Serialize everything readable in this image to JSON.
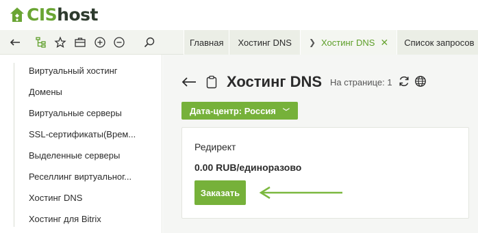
{
  "brand": {
    "logo_cis": "CIS",
    "logo_host": "host",
    "accent_color": "#76b13a"
  },
  "toolbar": {
    "icons": [
      "back-icon",
      "tree-icon",
      "star-icon",
      "briefcase-icon",
      "zoom-in-icon",
      "zoom-out-icon",
      "search-icon"
    ]
  },
  "tabs": [
    {
      "label": "Главная"
    },
    {
      "label": "Хостинг DNS"
    },
    {
      "label": "Хостинг DNS",
      "active": true
    },
    {
      "label": "Список запросов"
    }
  ],
  "sidebar": {
    "items": [
      {
        "label": "Виртуальный хостинг"
      },
      {
        "label": "Домены"
      },
      {
        "label": "Виртуальные серверы"
      },
      {
        "label": "SSL-сертификаты(Врем..."
      },
      {
        "label": "Выделенные серверы"
      },
      {
        "label": "Реселлинг виртуальног..."
      },
      {
        "label": "Хостинг DNS"
      },
      {
        "label": "Хостинг для Bitrix"
      }
    ]
  },
  "main": {
    "title": "Хостинг DNS",
    "per_page": "На странице: 1",
    "datacenter_button": "Дата-центр: Россия",
    "card": {
      "title": "Редирект",
      "price": "0.00 RUB/единоразово",
      "order_button": "Заказать"
    }
  }
}
